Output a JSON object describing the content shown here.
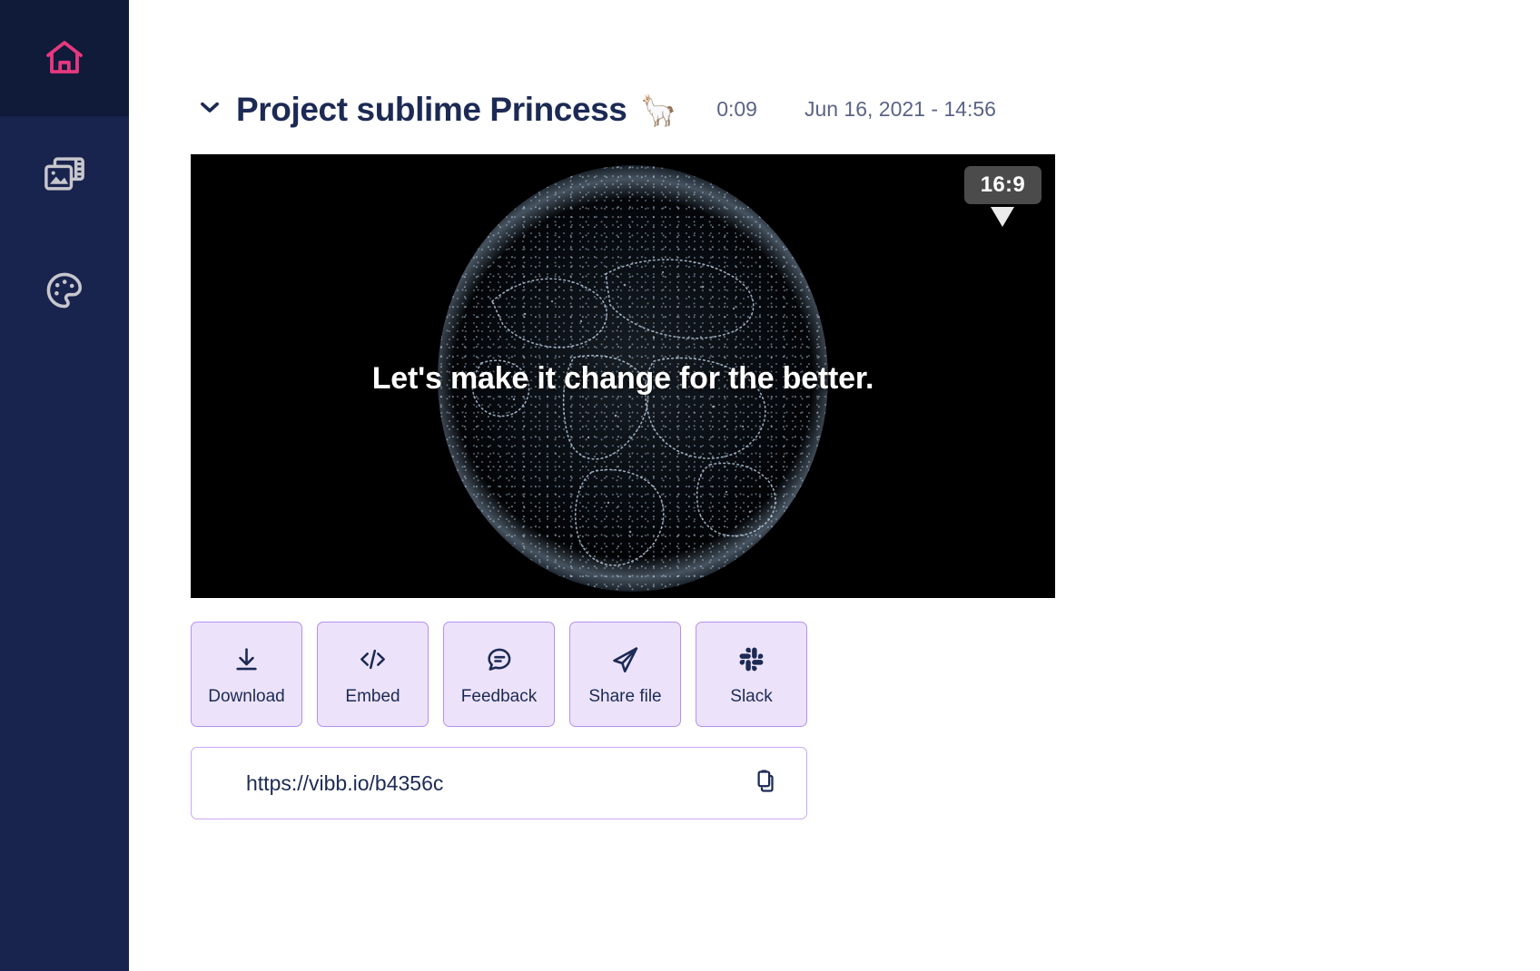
{
  "sidebar": {
    "items": [
      {
        "name": "home",
        "icon": "home-icon",
        "active": true
      },
      {
        "name": "media",
        "icon": "media-library-icon",
        "active": false
      },
      {
        "name": "branding",
        "icon": "palette-icon",
        "active": false
      }
    ],
    "colors": {
      "background": "#18234e",
      "active_background": "#101a39",
      "active_icon": "#e5387f",
      "icon": "#c6c6cc"
    }
  },
  "header": {
    "collapse_icon": "chevron-down-icon",
    "title": "Project sublime Princess",
    "emoji": "🦙",
    "duration": "0:09",
    "date": "Jun 16, 2021 - 14:56"
  },
  "player": {
    "caption": "Let's make it change for the better.",
    "aspect_ratio_badge": "16:9",
    "background_color": "#000000"
  },
  "actions": [
    {
      "label": "Download",
      "icon": "download-icon"
    },
    {
      "label": "Embed",
      "icon": "code-icon"
    },
    {
      "label": "Feedback",
      "icon": "comment-icon"
    },
    {
      "label": "Share file",
      "icon": "send-icon"
    },
    {
      "label": "Slack",
      "icon": "slack-icon"
    }
  ],
  "share_link": {
    "url": "https://vibb.io/b4356c",
    "copy_icon": "copy-icon"
  },
  "theme": {
    "accent_pink": "#e5387f",
    "navy": "#1c2a54",
    "button_fill": "#ece3fb",
    "button_border": "#b68ff0",
    "muted_text": "#5b6487"
  }
}
